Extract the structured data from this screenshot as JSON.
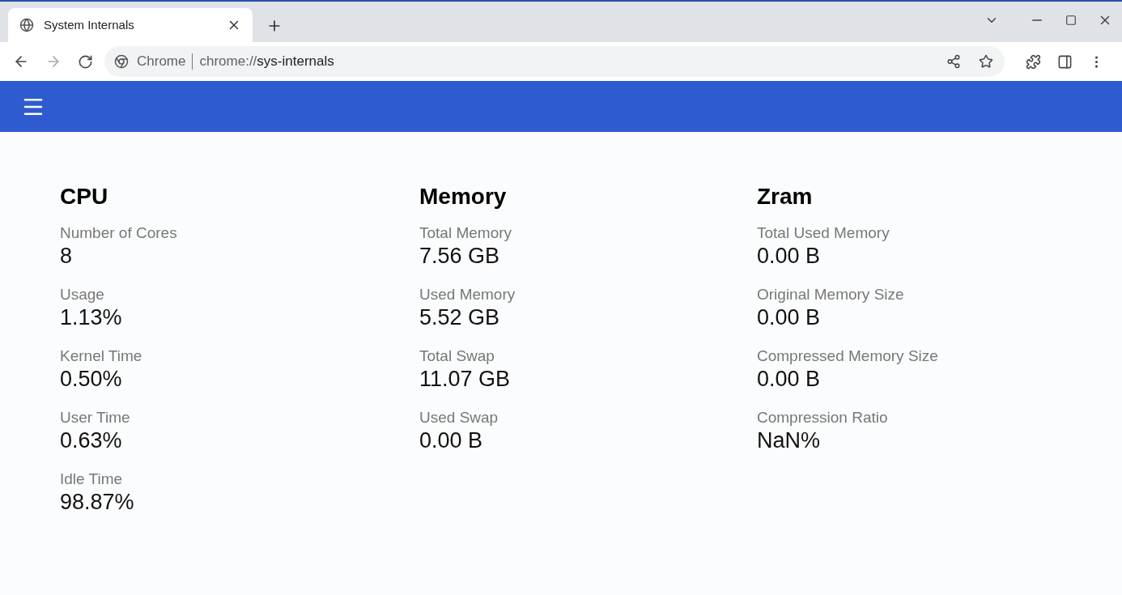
{
  "browser": {
    "tab": {
      "title": "System Internals",
      "selected": true
    },
    "address": {
      "chip": "Chrome",
      "scheme": "chrome://",
      "path": "sys-internals"
    }
  },
  "sections": [
    {
      "title": "CPU",
      "items": [
        {
          "label": "Number of Cores",
          "value": "8"
        },
        {
          "label": "Usage",
          "value": "1.13%"
        },
        {
          "label": "Kernel Time",
          "value": "0.50%"
        },
        {
          "label": "User Time",
          "value": "0.63%"
        },
        {
          "label": "Idle Time",
          "value": "98.87%"
        }
      ]
    },
    {
      "title": "Memory",
      "items": [
        {
          "label": "Total Memory",
          "value": "7.56 GB"
        },
        {
          "label": "Used Memory",
          "value": "5.52 GB"
        },
        {
          "label": "Total Swap",
          "value": "11.07 GB"
        },
        {
          "label": "Used Swap",
          "value": "0.00 B"
        }
      ]
    },
    {
      "title": "Zram",
      "items": [
        {
          "label": "Total Used Memory",
          "value": "0.00 B"
        },
        {
          "label": "Original Memory Size",
          "value": "0.00 B"
        },
        {
          "label": "Compressed Memory Size",
          "value": "0.00 B"
        },
        {
          "label": "Compression Ratio",
          "value": "NaN%"
        }
      ]
    }
  ]
}
